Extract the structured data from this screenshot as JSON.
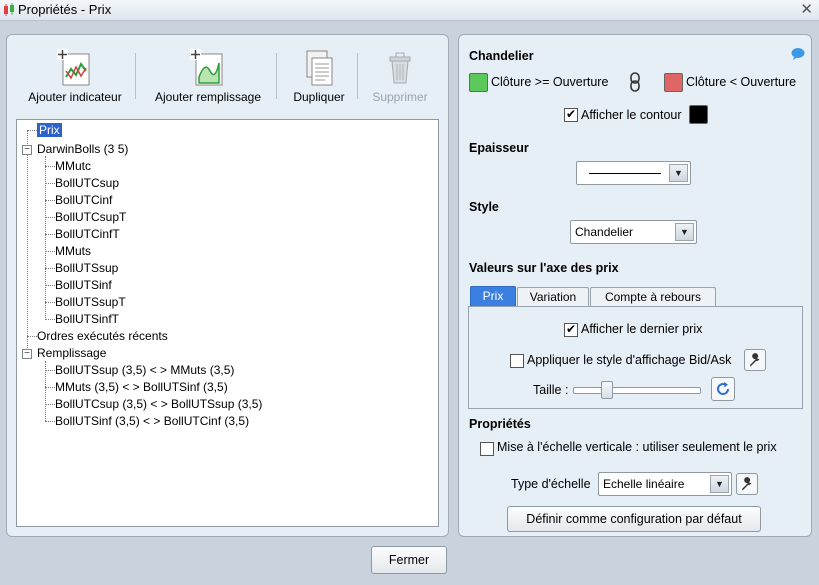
{
  "window": {
    "title": "Propriétés - Prix"
  },
  "toolbar": {
    "add_indicator": "Ajouter indicateur",
    "add_fill": "Ajouter remplissage",
    "duplicate": "Dupliquer",
    "delete": "Supprimer"
  },
  "tree": {
    "root": "Prix",
    "group1": "DarwinBolls (3 5)",
    "group1_items": [
      "MMutc",
      "BollUTCsup",
      "BollUTCinf",
      "BollUTCsupT",
      "BollUTCinfT",
      "MMuts",
      "BollUTSsup",
      "BollUTSinf",
      "BollUTSsupT",
      "BollUTSinfT"
    ],
    "orders": "Ordres exécutés récents",
    "group2": "Remplissage",
    "group2_items": [
      "BollUTSsup (3,5) < > MMuts (3,5)",
      "MMuts (3,5) < > BollUTSinf (3,5)",
      "BollUTCsup (3,5) < > BollUTSsup (3,5)",
      "BollUTSinf (3,5) < > BollUTCinf (3,5)"
    ]
  },
  "right": {
    "candle_heading": "Chandelier",
    "up_label": "Clôture >= Ouverture",
    "down_label": "Clôture < Ouverture",
    "up_color": "#5ac85a",
    "down_color": "#e06666",
    "contour_label": "Afficher le contour",
    "contour_color": "#000000",
    "thickness_heading": "Epaisseur",
    "style_heading": "Style",
    "style_value": "Chandelier",
    "axis_heading": "Valeurs sur l'axe des prix",
    "tabs": [
      "Prix",
      "Variation",
      "Compte à rebours"
    ],
    "show_last_price": "Afficher le dernier prix",
    "bid_ask": "Appliquer le style d'affichage Bid/Ask",
    "size_label": "Taille :",
    "properties_heading": "Propriétés",
    "vertical_scale": "Mise à l'échelle verticale : utiliser seulement le prix",
    "scale_type_label": "Type d'échelle",
    "scale_type_value": "Echelle linéaire",
    "default_button": "Définir comme configuration par défaut"
  },
  "footer": {
    "close": "Fermer"
  }
}
